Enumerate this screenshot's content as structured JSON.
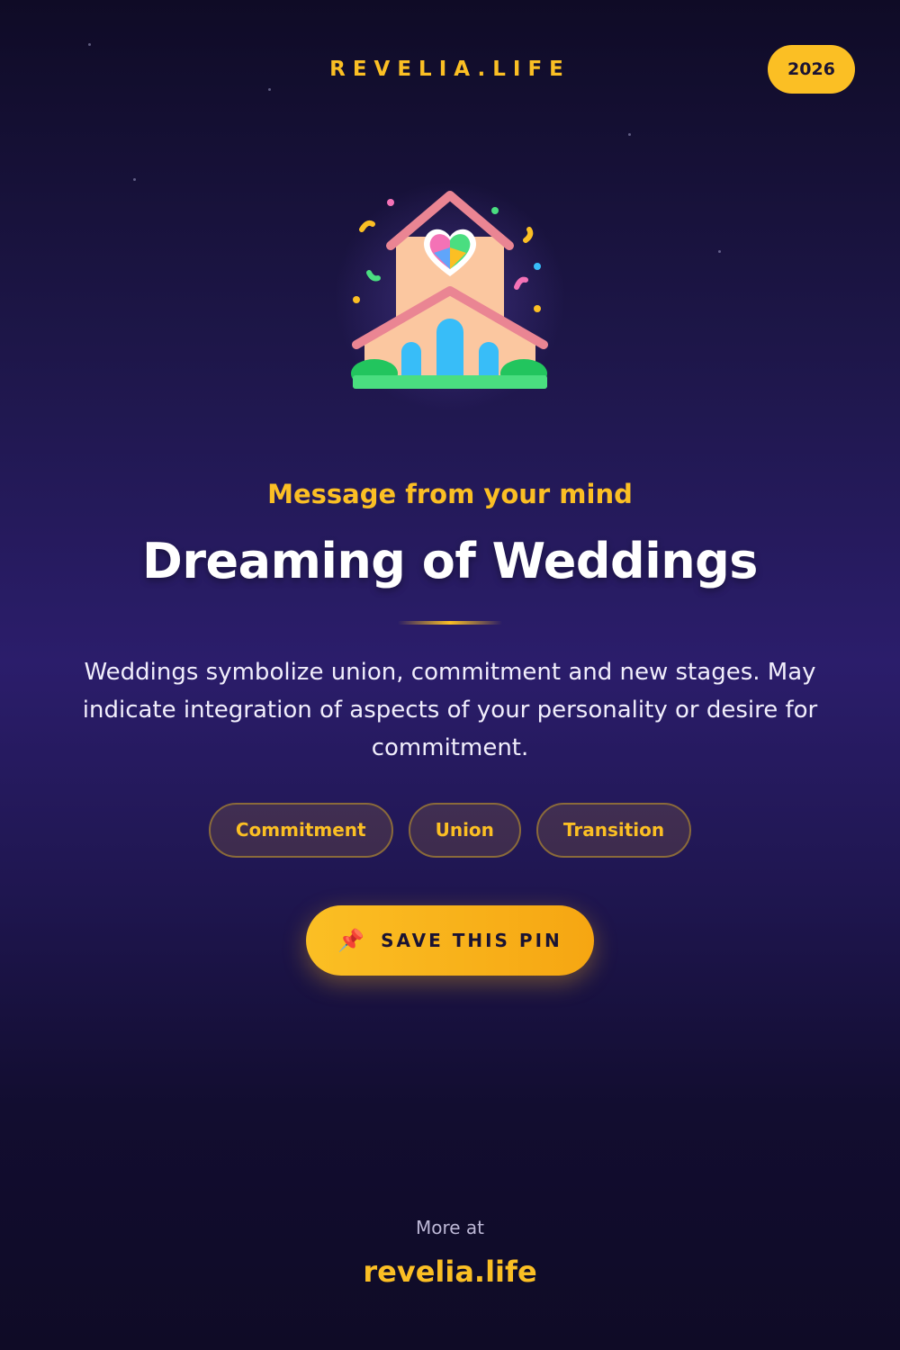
{
  "header": {
    "brand": "REVELIA.LIFE",
    "year": "2026"
  },
  "hero": {
    "icon": "wedding-chapel-icon"
  },
  "card": {
    "kicker": "Message from your mind",
    "title": "Dreaming of Weddings",
    "description": "Weddings symbolize union, commitment and new stages. May indicate integration of aspects of your personality or desire for commitment.",
    "tags": [
      "Commitment",
      "Union",
      "Transition"
    ]
  },
  "cta": {
    "icon": "pushpin-icon",
    "label": "SAVE THIS PIN"
  },
  "footer": {
    "more_label": "More at",
    "site": "revelia.life"
  },
  "colors": {
    "accent": "#fbbf24",
    "background": "#1d1648",
    "text": "#ffffff"
  }
}
